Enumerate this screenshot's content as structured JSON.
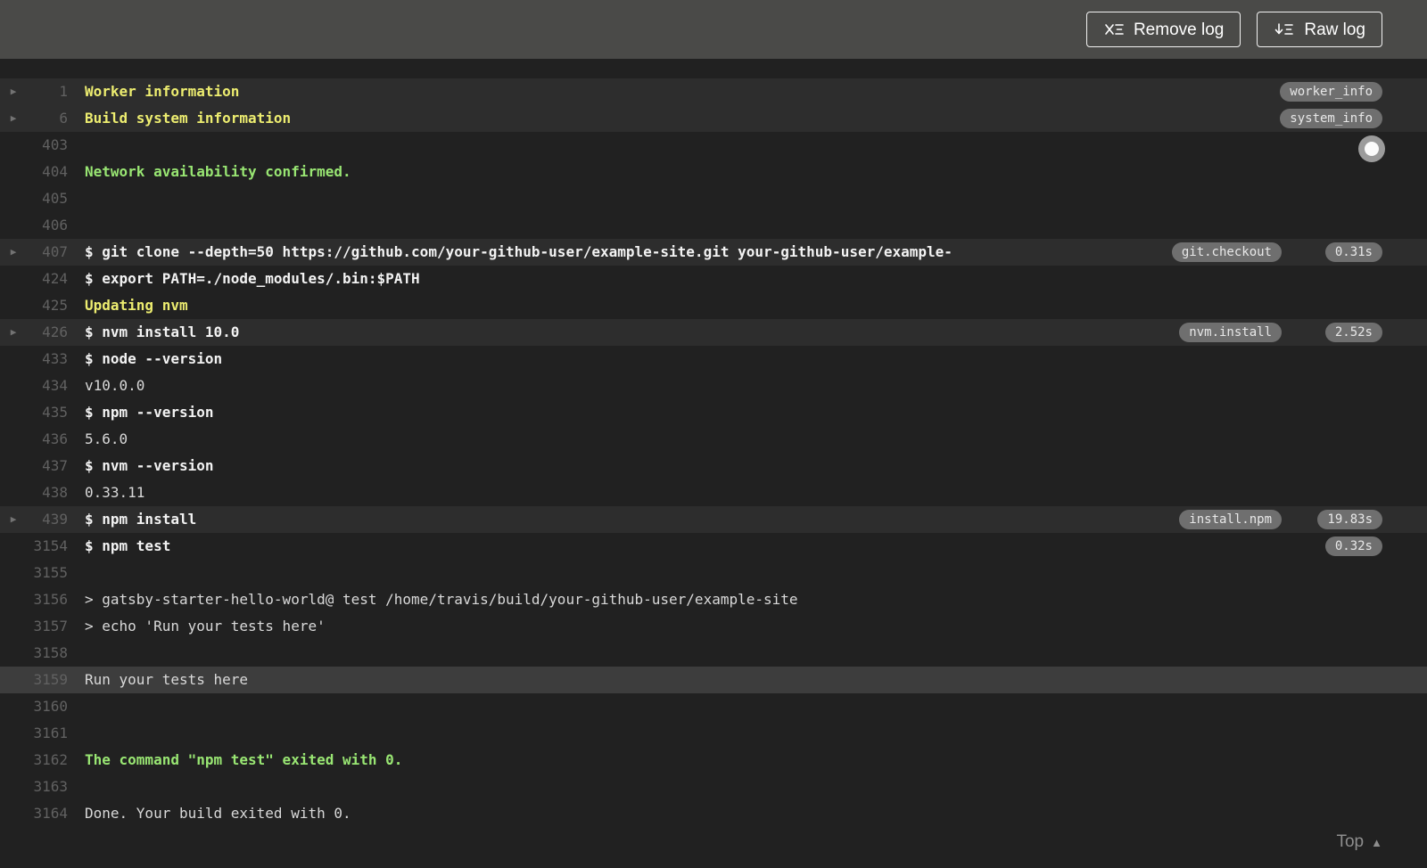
{
  "header": {
    "remove_log_label": "Remove log",
    "raw_log_label": "Raw log"
  },
  "colors": {
    "header_bg": "#4a4a48",
    "log_bg": "#212121",
    "fold_row_bg": "#2d2d2d",
    "highlight_row_bg": "#3d3d3d",
    "fold_title_yellow": "#eded70",
    "success_green": "#99e673",
    "badge_bg": "#6f6f6f"
  },
  "log": {
    "top_link": "Top",
    "lines": [
      {
        "num": "1",
        "text": "Worker information",
        "style": "yellow",
        "type": "fold-start",
        "badge": "worker_info"
      },
      {
        "num": "6",
        "text": "Build system information",
        "style": "yellow",
        "type": "fold-start",
        "badge": "system_info"
      },
      {
        "num": "403",
        "text": ""
      },
      {
        "num": "404",
        "text": "Network availability confirmed.",
        "style": "green"
      },
      {
        "num": "405",
        "text": ""
      },
      {
        "num": "406",
        "text": ""
      },
      {
        "num": "407",
        "text": "$ git clone --depth=50 https://github.com/your-github-user/example-site.git your-github-user/example-",
        "style": "command",
        "type": "fold-start",
        "badge": "git.checkout",
        "time": "0.31s"
      },
      {
        "num": "424",
        "text": "$ export PATH=./node_modules/.bin:$PATH",
        "style": "command"
      },
      {
        "num": "425",
        "text": "Updating nvm",
        "style": "yellow"
      },
      {
        "num": "426",
        "text": "$ nvm install 10.0",
        "style": "command",
        "type": "fold-start",
        "badge": "nvm.install",
        "time": "2.52s"
      },
      {
        "num": "433",
        "text": "$ node --version",
        "style": "command"
      },
      {
        "num": "434",
        "text": "v10.0.0"
      },
      {
        "num": "435",
        "text": "$ npm --version",
        "style": "command"
      },
      {
        "num": "436",
        "text": "5.6.0"
      },
      {
        "num": "437",
        "text": "$ nvm --version",
        "style": "command"
      },
      {
        "num": "438",
        "text": "0.33.11"
      },
      {
        "num": "439",
        "text": "$ npm install",
        "style": "command",
        "type": "fold-start",
        "badge": "install.npm",
        "time": "19.83s"
      },
      {
        "num": "3154",
        "text": "$ npm test",
        "style": "command",
        "time": "0.32s"
      },
      {
        "num": "3155",
        "text": ""
      },
      {
        "num": "3156",
        "text": "> gatsby-starter-hello-world@ test /home/travis/build/your-github-user/example-site"
      },
      {
        "num": "3157",
        "text": "> echo 'Run your tests here'"
      },
      {
        "num": "3158",
        "text": ""
      },
      {
        "num": "3159",
        "text": "Run your tests here",
        "highlight": true
      },
      {
        "num": "3160",
        "text": ""
      },
      {
        "num": "3161",
        "text": ""
      },
      {
        "num": "3162",
        "text": "The command \"npm test\" exited with 0.",
        "style": "green"
      },
      {
        "num": "3163",
        "text": ""
      },
      {
        "num": "3164",
        "text": "Done. Your build exited with 0."
      }
    ]
  }
}
